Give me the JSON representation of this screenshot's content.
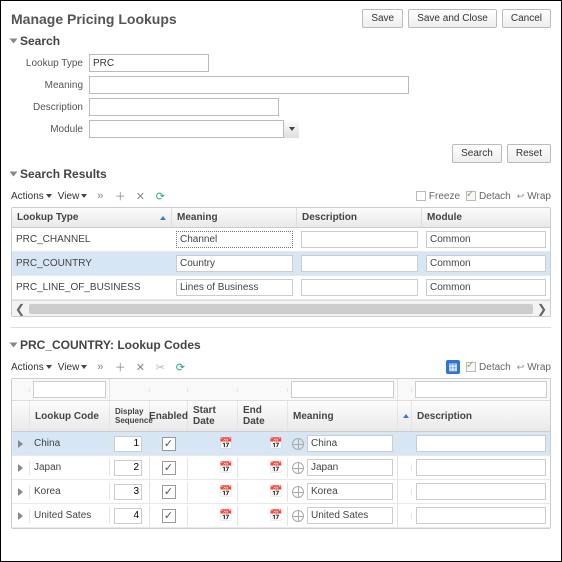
{
  "header": {
    "title": "Manage Pricing Lookups",
    "buttons": {
      "save": "Save",
      "save_close": "Save and Close",
      "cancel": "Cancel"
    }
  },
  "search": {
    "title": "Search",
    "labels": {
      "lookup_type": "Lookup Type",
      "meaning": "Meaning",
      "description": "Description",
      "module": "Module"
    },
    "values": {
      "lookup_type": "PRC",
      "meaning": "",
      "description": "",
      "module": ""
    },
    "buttons": {
      "search": "Search",
      "reset": "Reset"
    }
  },
  "results": {
    "title": "Search Results",
    "toolbar": {
      "actions": "Actions",
      "view": "View",
      "freeze": "Freeze",
      "detach": "Detach",
      "wrap": "Wrap"
    },
    "columns": {
      "lookup_type": "Lookup Type",
      "meaning": "Meaning",
      "description": "Description",
      "module": "Module"
    },
    "rows": [
      {
        "lookup_type": "PRC_CHANNEL",
        "meaning": "Channel",
        "description": "",
        "module": "Common",
        "selected": false,
        "editing": true
      },
      {
        "lookup_type": "PRC_COUNTRY",
        "meaning": "Country",
        "description": "",
        "module": "Common",
        "selected": true,
        "editing": false
      },
      {
        "lookup_type": "PRC_LINE_OF_BUSINESS",
        "meaning": "Lines of Business",
        "description": "",
        "module": "Common",
        "selected": false,
        "editing": false
      }
    ]
  },
  "codes": {
    "title": "PRC_COUNTRY: Lookup Codes",
    "toolbar": {
      "actions": "Actions",
      "view": "View",
      "detach": "Detach",
      "wrap": "Wrap"
    },
    "columns": {
      "lookup_code": "Lookup Code",
      "display_seq": "Display Sequence",
      "enabled": "Enabled",
      "start_date": "Start Date",
      "end_date": "End Date",
      "meaning": "Meaning",
      "description": "Description"
    },
    "rows": [
      {
        "code": "China",
        "seq": "1",
        "enabled": true,
        "start": "",
        "end": "",
        "meaning": "China",
        "desc": "",
        "selected": true
      },
      {
        "code": "Japan",
        "seq": "2",
        "enabled": true,
        "start": "",
        "end": "",
        "meaning": "Japan",
        "desc": "",
        "selected": false
      },
      {
        "code": "Korea",
        "seq": "3",
        "enabled": true,
        "start": "",
        "end": "",
        "meaning": "Korea",
        "desc": "",
        "selected": false
      },
      {
        "code": "United Sates",
        "seq": "4",
        "enabled": true,
        "start": "",
        "end": "",
        "meaning": "United Sates",
        "desc": "",
        "selected": false
      }
    ]
  }
}
